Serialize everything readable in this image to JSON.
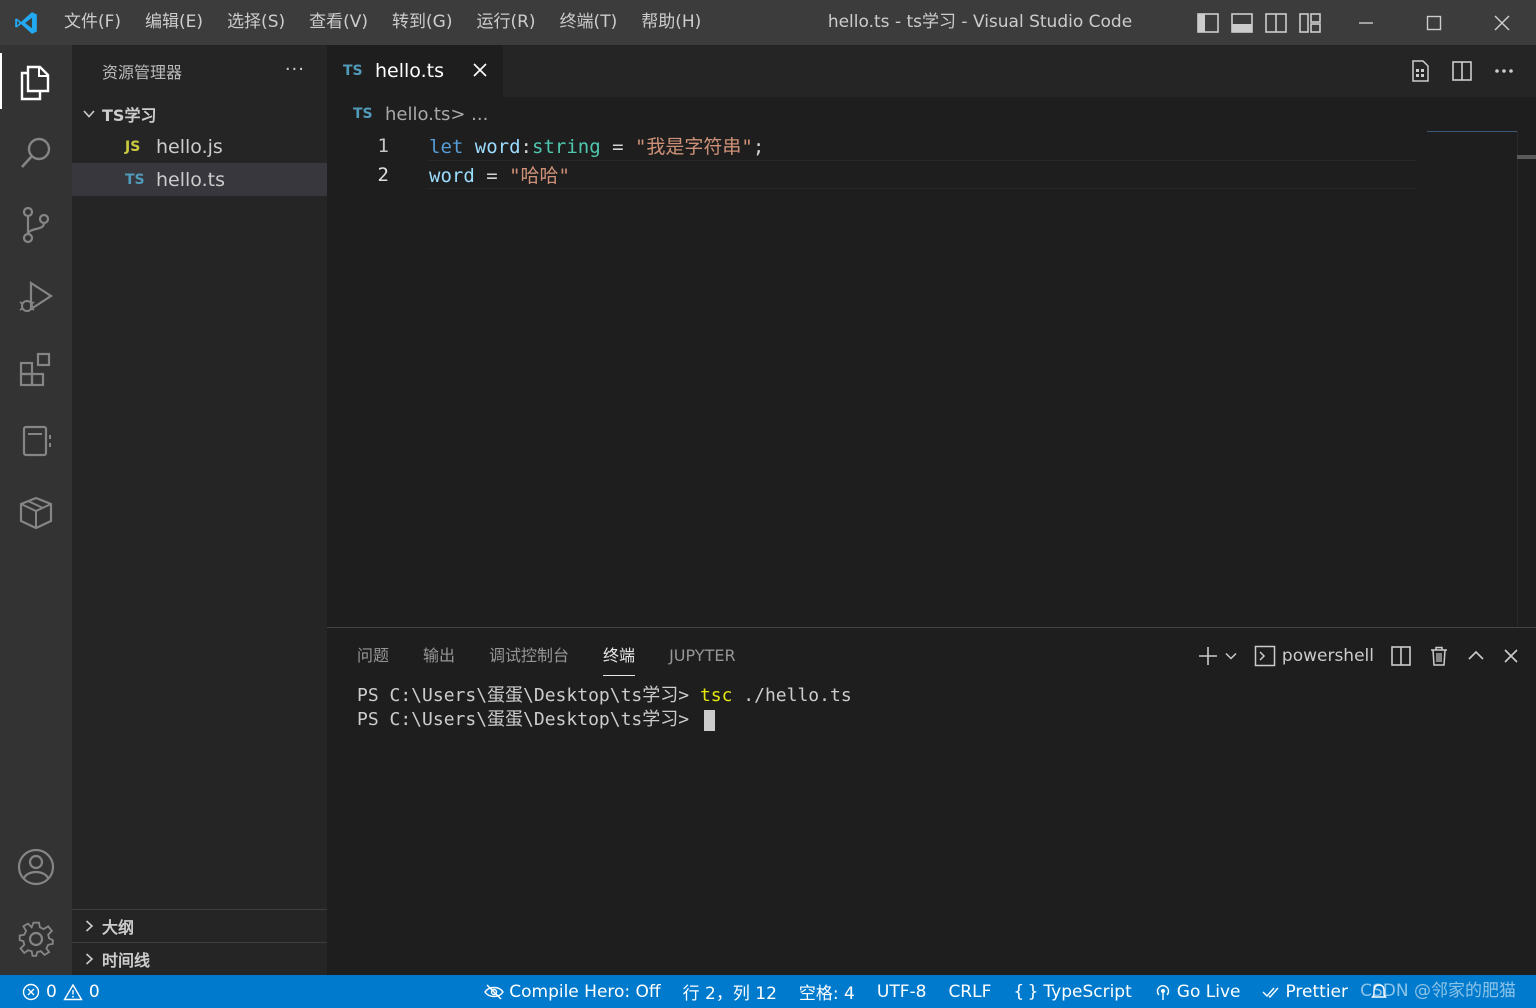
{
  "window": {
    "title": "hello.ts - ts学习 - Visual Studio Code"
  },
  "menu": [
    "文件(F)",
    "编辑(E)",
    "选择(S)",
    "查看(V)",
    "转到(G)",
    "运行(R)",
    "终端(T)",
    "帮助(H)"
  ],
  "explorer": {
    "header": "资源管理器",
    "more": "···",
    "folder": "TS学习",
    "files": [
      {
        "badge": "JS",
        "name": "hello.js"
      },
      {
        "badge": "TS",
        "name": "hello.ts"
      }
    ],
    "sections": [
      "大纲",
      "时间线"
    ]
  },
  "editor": {
    "tab": {
      "badge": "TS",
      "label": "hello.ts"
    },
    "breadcrumb": {
      "badge": "TS",
      "file": "hello.ts",
      "sep": " > ..."
    },
    "lines": [
      {
        "num": "1",
        "tokens": {
          "kw": "let",
          "var": "word",
          "colon": ":",
          "type": "string",
          "eq": " = ",
          "str": "\"我是字符串\"",
          "semi": ";"
        }
      },
      {
        "num": "2",
        "tokens": {
          "var": "word",
          "eq": " = ",
          "str": "\"哈哈\""
        }
      }
    ]
  },
  "panel": {
    "tabs": [
      "问题",
      "输出",
      "调试控制台",
      "终端",
      "JUPYTER"
    ],
    "active_tab": "终端",
    "terminal_name": "powershell",
    "lines": [
      {
        "prompt": "PS C:\\Users\\蛋蛋\\Desktop\\ts学习> ",
        "cmd": "tsc",
        "args": " ./hello.ts"
      },
      {
        "prompt": "PS C:\\Users\\蛋蛋\\Desktop\\ts学习> "
      }
    ]
  },
  "statusbar": {
    "errors": "0",
    "warnings": "0",
    "compile_hero": "Compile Hero: Off",
    "position": "行 2，列 12",
    "spaces": "空格: 4",
    "encoding": "UTF-8",
    "eol": "CRLF",
    "language": "TypeScript",
    "golive": "Go Live",
    "prettier": "Prettier",
    "watermark": "CSDN @邻家的肥猫"
  },
  "colors": {
    "accent": "#007acc",
    "keyword": "#569cd6",
    "variable": "#9cdcfe",
    "type": "#4ec9b0",
    "string": "#ce9178"
  }
}
